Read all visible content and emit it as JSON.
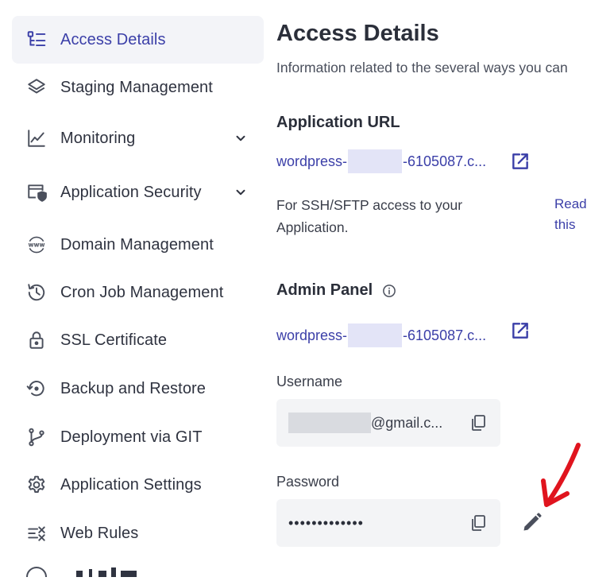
{
  "sidebar": {
    "items": [
      {
        "label": "Access Details",
        "icon": "access-details-icon",
        "active": true
      },
      {
        "label": "Staging Management",
        "icon": "layers-icon"
      },
      {
        "label": "Monitoring",
        "icon": "chart-line-icon",
        "expandable": true
      },
      {
        "label": "Application Security",
        "icon": "security-shield-icon",
        "expandable": true
      },
      {
        "label": "Domain Management",
        "icon": "www-globe-icon"
      },
      {
        "label": "Cron Job Management",
        "icon": "history-clock-icon"
      },
      {
        "label": "SSL Certificate",
        "icon": "lock-icon"
      },
      {
        "label": "Backup and Restore",
        "icon": "restore-icon"
      },
      {
        "label": "Deployment via GIT",
        "icon": "git-branch-icon"
      },
      {
        "label": "Application Settings",
        "icon": "gear-icon"
      },
      {
        "label": "Web Rules",
        "icon": "rules-icon"
      }
    ]
  },
  "main": {
    "title": "Access Details",
    "description": "Information related to the several ways you can",
    "app_url": {
      "heading": "Application URL",
      "link_prefix": "wordpress-",
      "link_suffix": "-6105087.c...",
      "ssh_note": "For SSH/SFTP access to your Application.",
      "read_link": "Read this"
    },
    "admin_panel": {
      "heading": "Admin Panel",
      "link_prefix": "wordpress-",
      "link_suffix": "-6105087.c...",
      "username_label": "Username",
      "username_suffix": "@gmail.c...",
      "password_label": "Password",
      "password_value": "•••••••••••••"
    }
  },
  "colors": {
    "accent": "#3b3fa8",
    "active_bg": "#f3f4f8",
    "field_bg": "#f3f4f6",
    "annotation_arrow": "#e0141e"
  }
}
